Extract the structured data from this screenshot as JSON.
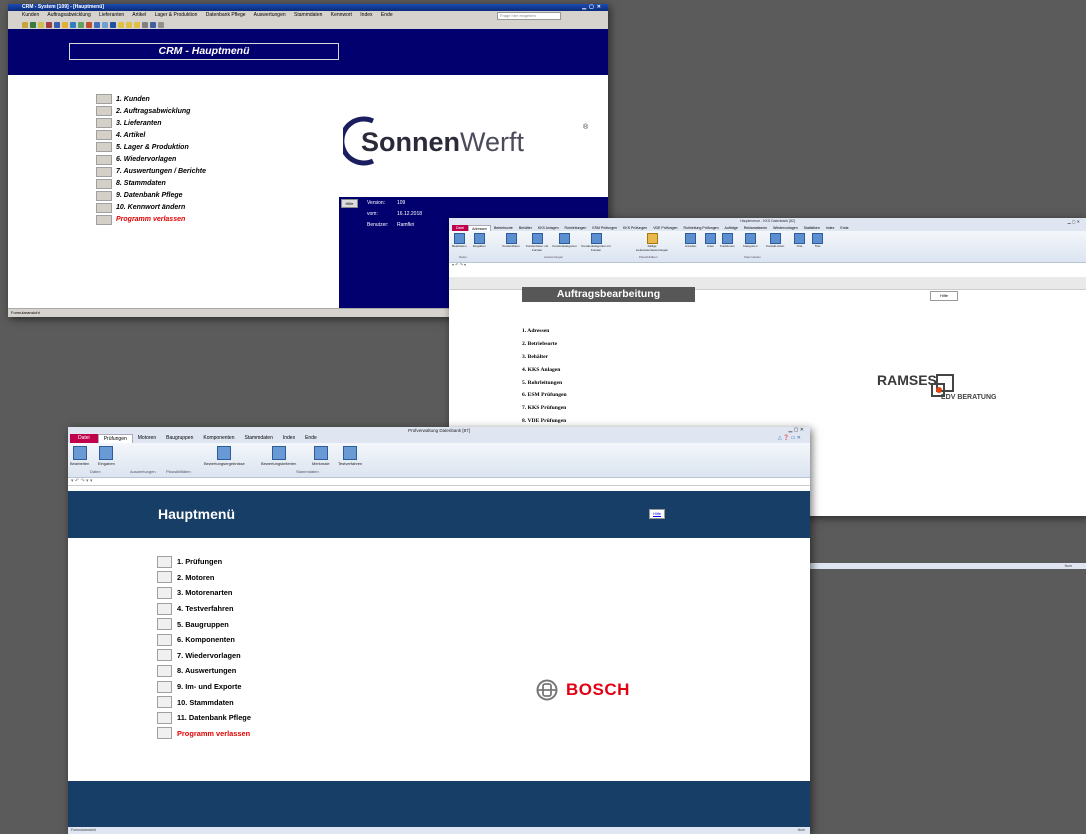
{
  "crm": {
    "title": "CRM - System [109] - [Hauptmenü]",
    "menu": [
      "Kunden",
      "Auftragsabwicklung",
      "Lieferanten",
      "Artikel",
      "Lager & Produktion",
      "Datenbank Pflege",
      "Auswertungen",
      "Stammdaten",
      "Kennwort",
      "Index",
      "Ende"
    ],
    "ask_placeholder": "Frage hier eingeben",
    "heading": "CRM - Hauptmenü",
    "nav": [
      "1. Kunden",
      "2. Auftragsabwicklung",
      "3. Lieferanten",
      "4. Artikel",
      "5. Lager & Produktion",
      "6. Wiedervorlagen",
      "7. Auswertungen / Berichte",
      "8. Stammdaten",
      "9. Datenbank Pflege",
      "10. Kennwort ändern",
      "Programm verlassen"
    ],
    "logo": {
      "part1": "Sonnen",
      "part2": "Werft",
      "mark": "®"
    },
    "help_label": "Hilfe",
    "info": {
      "version_label": "Version:",
      "version": "109",
      "date_label": "vom:",
      "date": "16.12.2018",
      "user_label": "Benutzer:",
      "user": "Ramfkri"
    },
    "status": "Formularansicht",
    "colors": {
      "navy": "#02006f",
      "exit": "#e00000"
    }
  },
  "ramses": {
    "title": "Hauptmenue - KKS Datenbank [82]",
    "tabs": [
      "Datei",
      "Adressen",
      "Betriebsorte",
      "Behälter",
      "KKS Anlagen",
      "Rohrleitungen",
      "ESM Prüfungen",
      "KKS Prüfungen",
      "VDE Prüfungen",
      "Rohrleitung Prüfungen",
      "Aufträge",
      "Reklamationen",
      "Wiedervorlagen",
      "Statistiken",
      "Index",
      "Ende"
    ],
    "ribbon_buttons": [
      "Bearbeiten",
      "Eingaben",
      "Kundenlisten",
      "Kundenlisten mit Kunden",
      "Kundenkategorien",
      "Kundenkategorien mit Kunden",
      "Fällige Lieferantenbewertungen",
      "Anreden",
      "Arten",
      "Funktionen",
      "Kategorien",
      "Kontakt-Arten",
      "Orte",
      "Titel"
    ],
    "ribbon_groups": [
      "Daten",
      "Auswertungen",
      "Plausibilitäten",
      "Stammdaten"
    ],
    "heading": "Auftragsbearbeitung",
    "help_label": "Hilfe",
    "nav": [
      "1. Adressen",
      "2. Betriebsorte",
      "3. Behälter",
      "4. KKS Anlagen",
      "5. Rohrleitungen",
      "6. ESM Prüfungen",
      "7. KKS Prüfungen",
      "8. VDE Prüfungen"
    ],
    "logo": {
      "name": "RAMSES",
      "sub": "EDV BERATUNG"
    },
    "status_right": "Num"
  },
  "bosch": {
    "title": "Prüfverwaltung Datenbank [87]",
    "tabs": [
      "Datei",
      "Prüfungen",
      "Motoren",
      "Baugruppen",
      "Komponenten",
      "Stammdaten",
      "Index",
      "Ende"
    ],
    "ribbon_buttons": [
      "Bearbeiten",
      "Eingaben",
      "Bewertungsergebnisse",
      "Bewertungskriterien",
      "Merkmale",
      "Testverfahren"
    ],
    "ribbon_groups": [
      "Daten",
      "Auswertungen",
      "Plausibilitäten",
      "Stammdaten"
    ],
    "heading": "Hauptmenü",
    "help_label": "Hilfe",
    "nav": [
      "1. Prüfungen",
      "2. Motoren",
      "3. Motorenarten",
      "4. Testverfahren",
      "5. Baugruppen",
      "6. Komponenten",
      "7. Wiedervorlagen",
      "8. Auswertungen",
      "9. Im- und Exporte",
      "10. Stammdaten",
      "11. Datenbank Pflege",
      "Programm verlassen"
    ],
    "logo": "BOSCH",
    "status": "Formularansicht",
    "status_right": "Num",
    "colors": {
      "navy": "#163e66",
      "bosch_red": "#e20015",
      "datei_tab": "#c0004a"
    }
  }
}
